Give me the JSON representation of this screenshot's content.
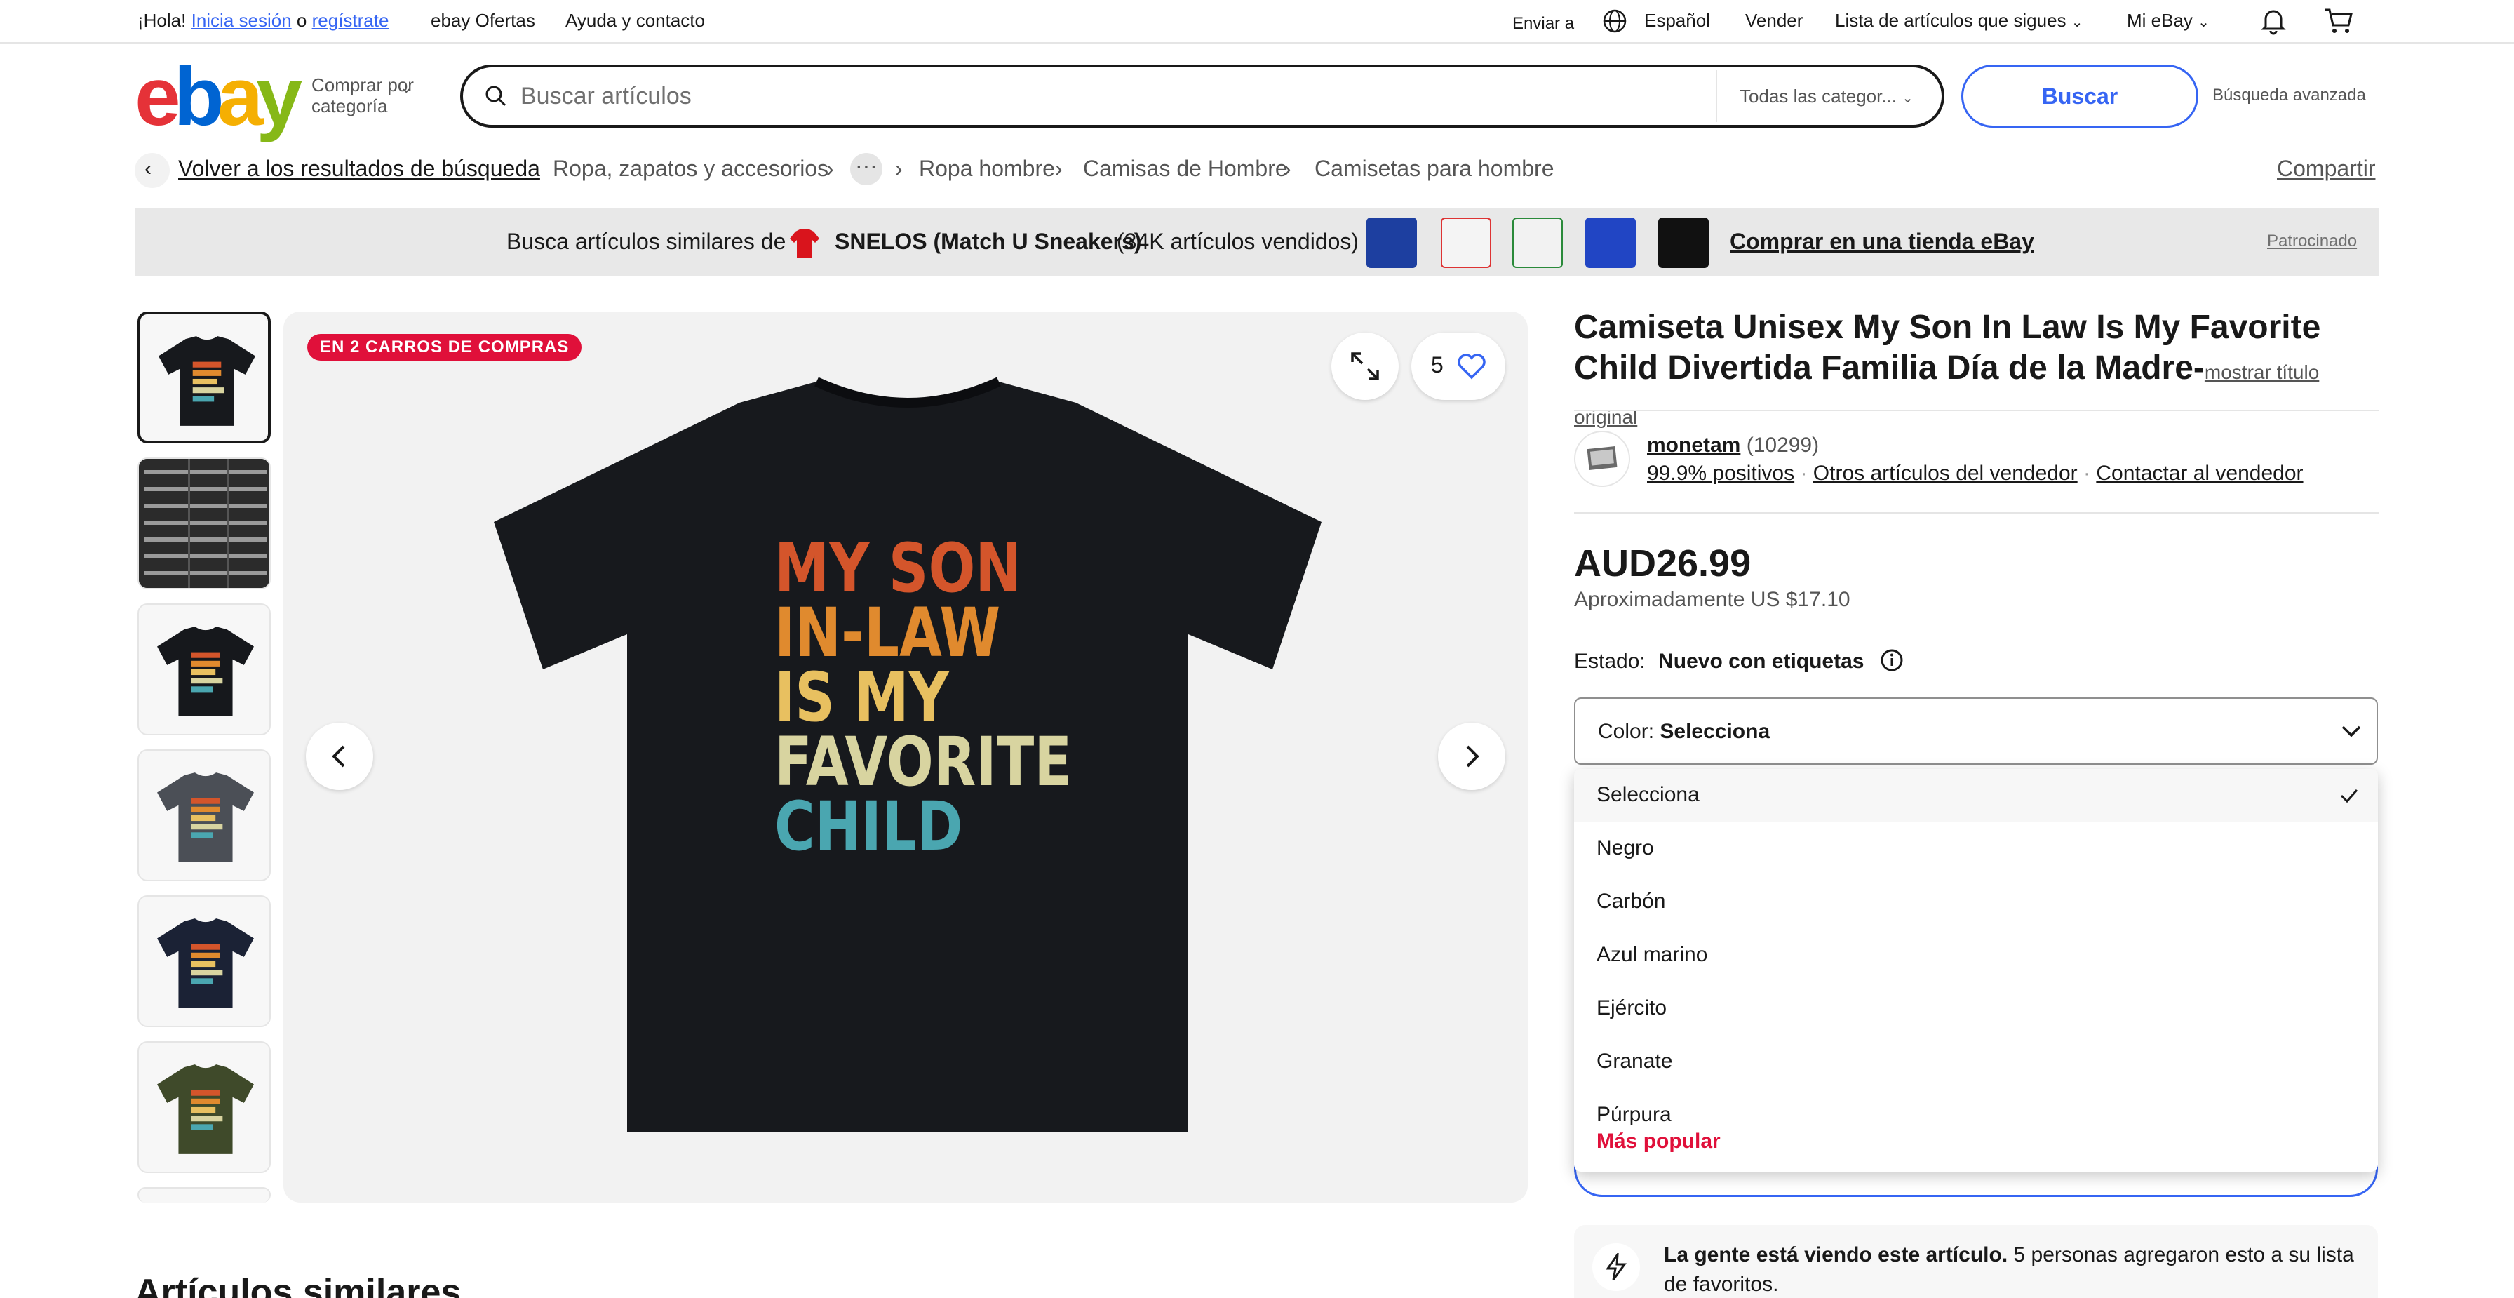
{
  "topbar": {
    "greeting": "¡Hola!",
    "signin": "Inicia sesión",
    "or": "o",
    "register": "regístrate",
    "deals": "ebay Ofertas",
    "help": "Ayuda y contacto",
    "ship_to": "Enviar a",
    "language": "Español",
    "sell": "Vender",
    "watchlist": "Lista de artículos que sigues",
    "my_ebay": "Mi eBay"
  },
  "header": {
    "logo_letters": [
      "e",
      "b",
      "a",
      "y"
    ],
    "shop_by_category": "Comprar por categoría",
    "search_placeholder": "Buscar artículos",
    "category_select": "Todas las categor...",
    "search_button": "Buscar",
    "advanced": "Búsqueda avanzada"
  },
  "breadcrumb": {
    "back": "Volver a los resultados de búsqueda",
    "items": [
      "Ropa, zapatos y accesorios",
      "Ropa hombre",
      "Camisas de Hombre",
      "Camisetas para hombre"
    ],
    "share": "Compartir"
  },
  "sponsored": {
    "lead": "Busca artículos similares de",
    "store": "SNELOS (Match U Sneakers)",
    "sold": "(34K artículos vendidos)",
    "cta": "Comprar en una tienda eBay",
    "tag": "Patrocinado"
  },
  "gallery": {
    "badge": "EN 2 CARROS DE COMPRAS",
    "watch_count": "5",
    "shirt_text": [
      "MY SON",
      "IN-LAW",
      "IS MY",
      "FAVORITE",
      "CHILD"
    ],
    "thumb_colors": [
      "#17191d",
      "#5a5a5a",
      "#16181c",
      "#4b4f56",
      "#1b2235",
      "#3f4a2a"
    ]
  },
  "product": {
    "title": "Camiseta Unisex My Son In Law Is My Favorite Child Divertida Familia Día de la Madre-",
    "show_original": "mostrar título original",
    "seller_name": "monetam",
    "seller_score": "(10299)",
    "positive": "99.9% positivos",
    "other_items": "Otros artículos del vendedor",
    "contact": "Contactar al vendedor",
    "price": "AUD26.99",
    "approx": "Aproximadamente US $17.10",
    "condition_label": "Estado:",
    "condition_value": "Nuevo con etiquetas"
  },
  "color_select": {
    "label": "Color:",
    "value": "Selecciona",
    "options": [
      "Selecciona",
      "Negro",
      "Carbón",
      "Azul marino",
      "Ejército",
      "Granate",
      "Púrpura"
    ],
    "popular_tag": "Más popular"
  },
  "social_proof": {
    "bold": "La gente está viendo este artículo.",
    "rest": "5 personas agregaron esto a su lista de favoritos."
  },
  "similar_heading": "Artículos similares"
}
